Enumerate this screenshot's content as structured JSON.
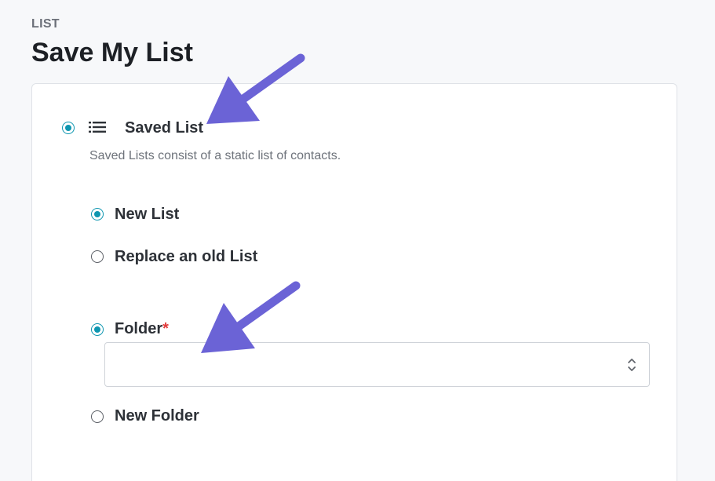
{
  "header": {
    "eyebrow": "LIST",
    "title": "Save My List"
  },
  "list_type": {
    "selected": true,
    "icon": "list-icon",
    "label": "Saved List",
    "helper": "Saved Lists consist of a static list of contacts."
  },
  "list_mode": {
    "options": [
      {
        "label": "New List",
        "selected": true
      },
      {
        "label": "Replace an old List",
        "selected": false
      }
    ]
  },
  "folder": {
    "options": [
      {
        "label": "Folder",
        "required_mark": "*",
        "selected": true
      },
      {
        "label": "New Folder",
        "selected": false
      }
    ],
    "select": {
      "value": "",
      "icon": "chevron-updown-icon"
    }
  },
  "annotations": {
    "arrow_color": "#6b63d6"
  },
  "colors": {
    "accent": "#0e96b0",
    "required": "#e23b3b"
  }
}
